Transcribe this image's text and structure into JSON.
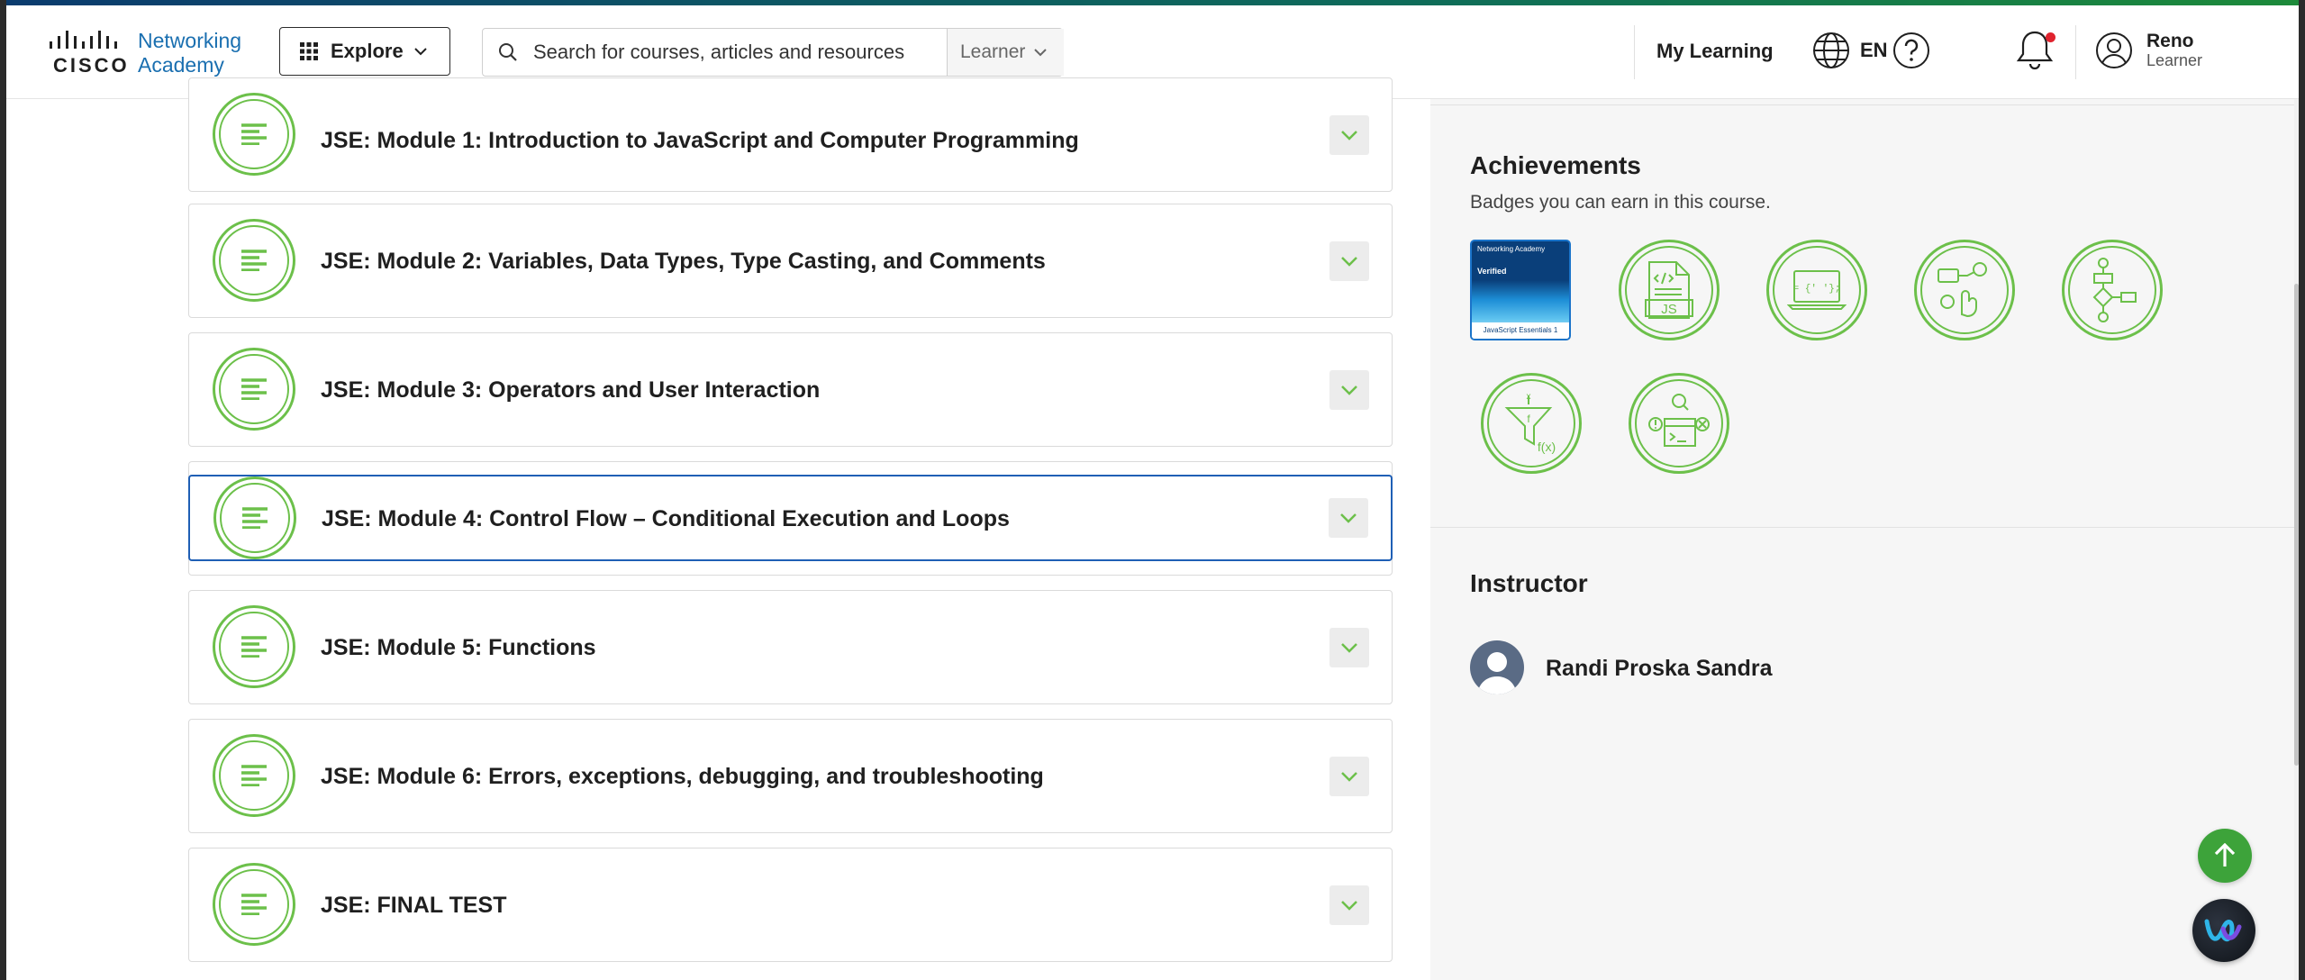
{
  "header": {
    "logo_brand_line1": "Networking",
    "logo_brand_line2": "Academy",
    "logo_wordmark": "CISCO",
    "explore_label": "Explore",
    "search_placeholder": "Search for courses, articles and resources",
    "role_selected": "Learner",
    "my_learning_label": "My Learning",
    "language_code": "EN",
    "user_name": "Reno",
    "user_role": "Learner"
  },
  "modules": [
    {
      "title": "JSE: Module 1: Introduction to JavaScript and Computer Programming"
    },
    {
      "title": "JSE: Module 2: Variables, Data Types, Type Casting, and Comments"
    },
    {
      "title": "JSE: Module 3: Operators and User Interaction"
    },
    {
      "title": "JSE: Module 4: Control Flow – Conditional Execution and Loops"
    },
    {
      "title": "JSE: Module 5: Functions"
    },
    {
      "title": "JSE: Module 6: Errors, exceptions, debugging, and troubleshooting"
    },
    {
      "title": "JSE: FINAL TEST"
    }
  ],
  "achievements": {
    "title": "Achievements",
    "subtitle": "Badges you can earn in this course.",
    "verified_badge": {
      "top_text": "Networking Academy",
      "verified_label": "Verified",
      "footer_text": "JavaScript Essentials 1"
    },
    "badges": [
      "js-file-badge-icon",
      "laptop-code-badge-icon",
      "interaction-badge-icon",
      "flowchart-badge-icon",
      "function-filter-badge-icon",
      "debug-console-badge-icon"
    ]
  },
  "instructor": {
    "title": "Instructor",
    "name": "Randi Proska Sandra"
  },
  "colors": {
    "accent_green": "#6cc04a",
    "selected_border": "#1f5fb5",
    "link_blue": "#1a6fb0",
    "notification_dot": "#e0232e"
  }
}
